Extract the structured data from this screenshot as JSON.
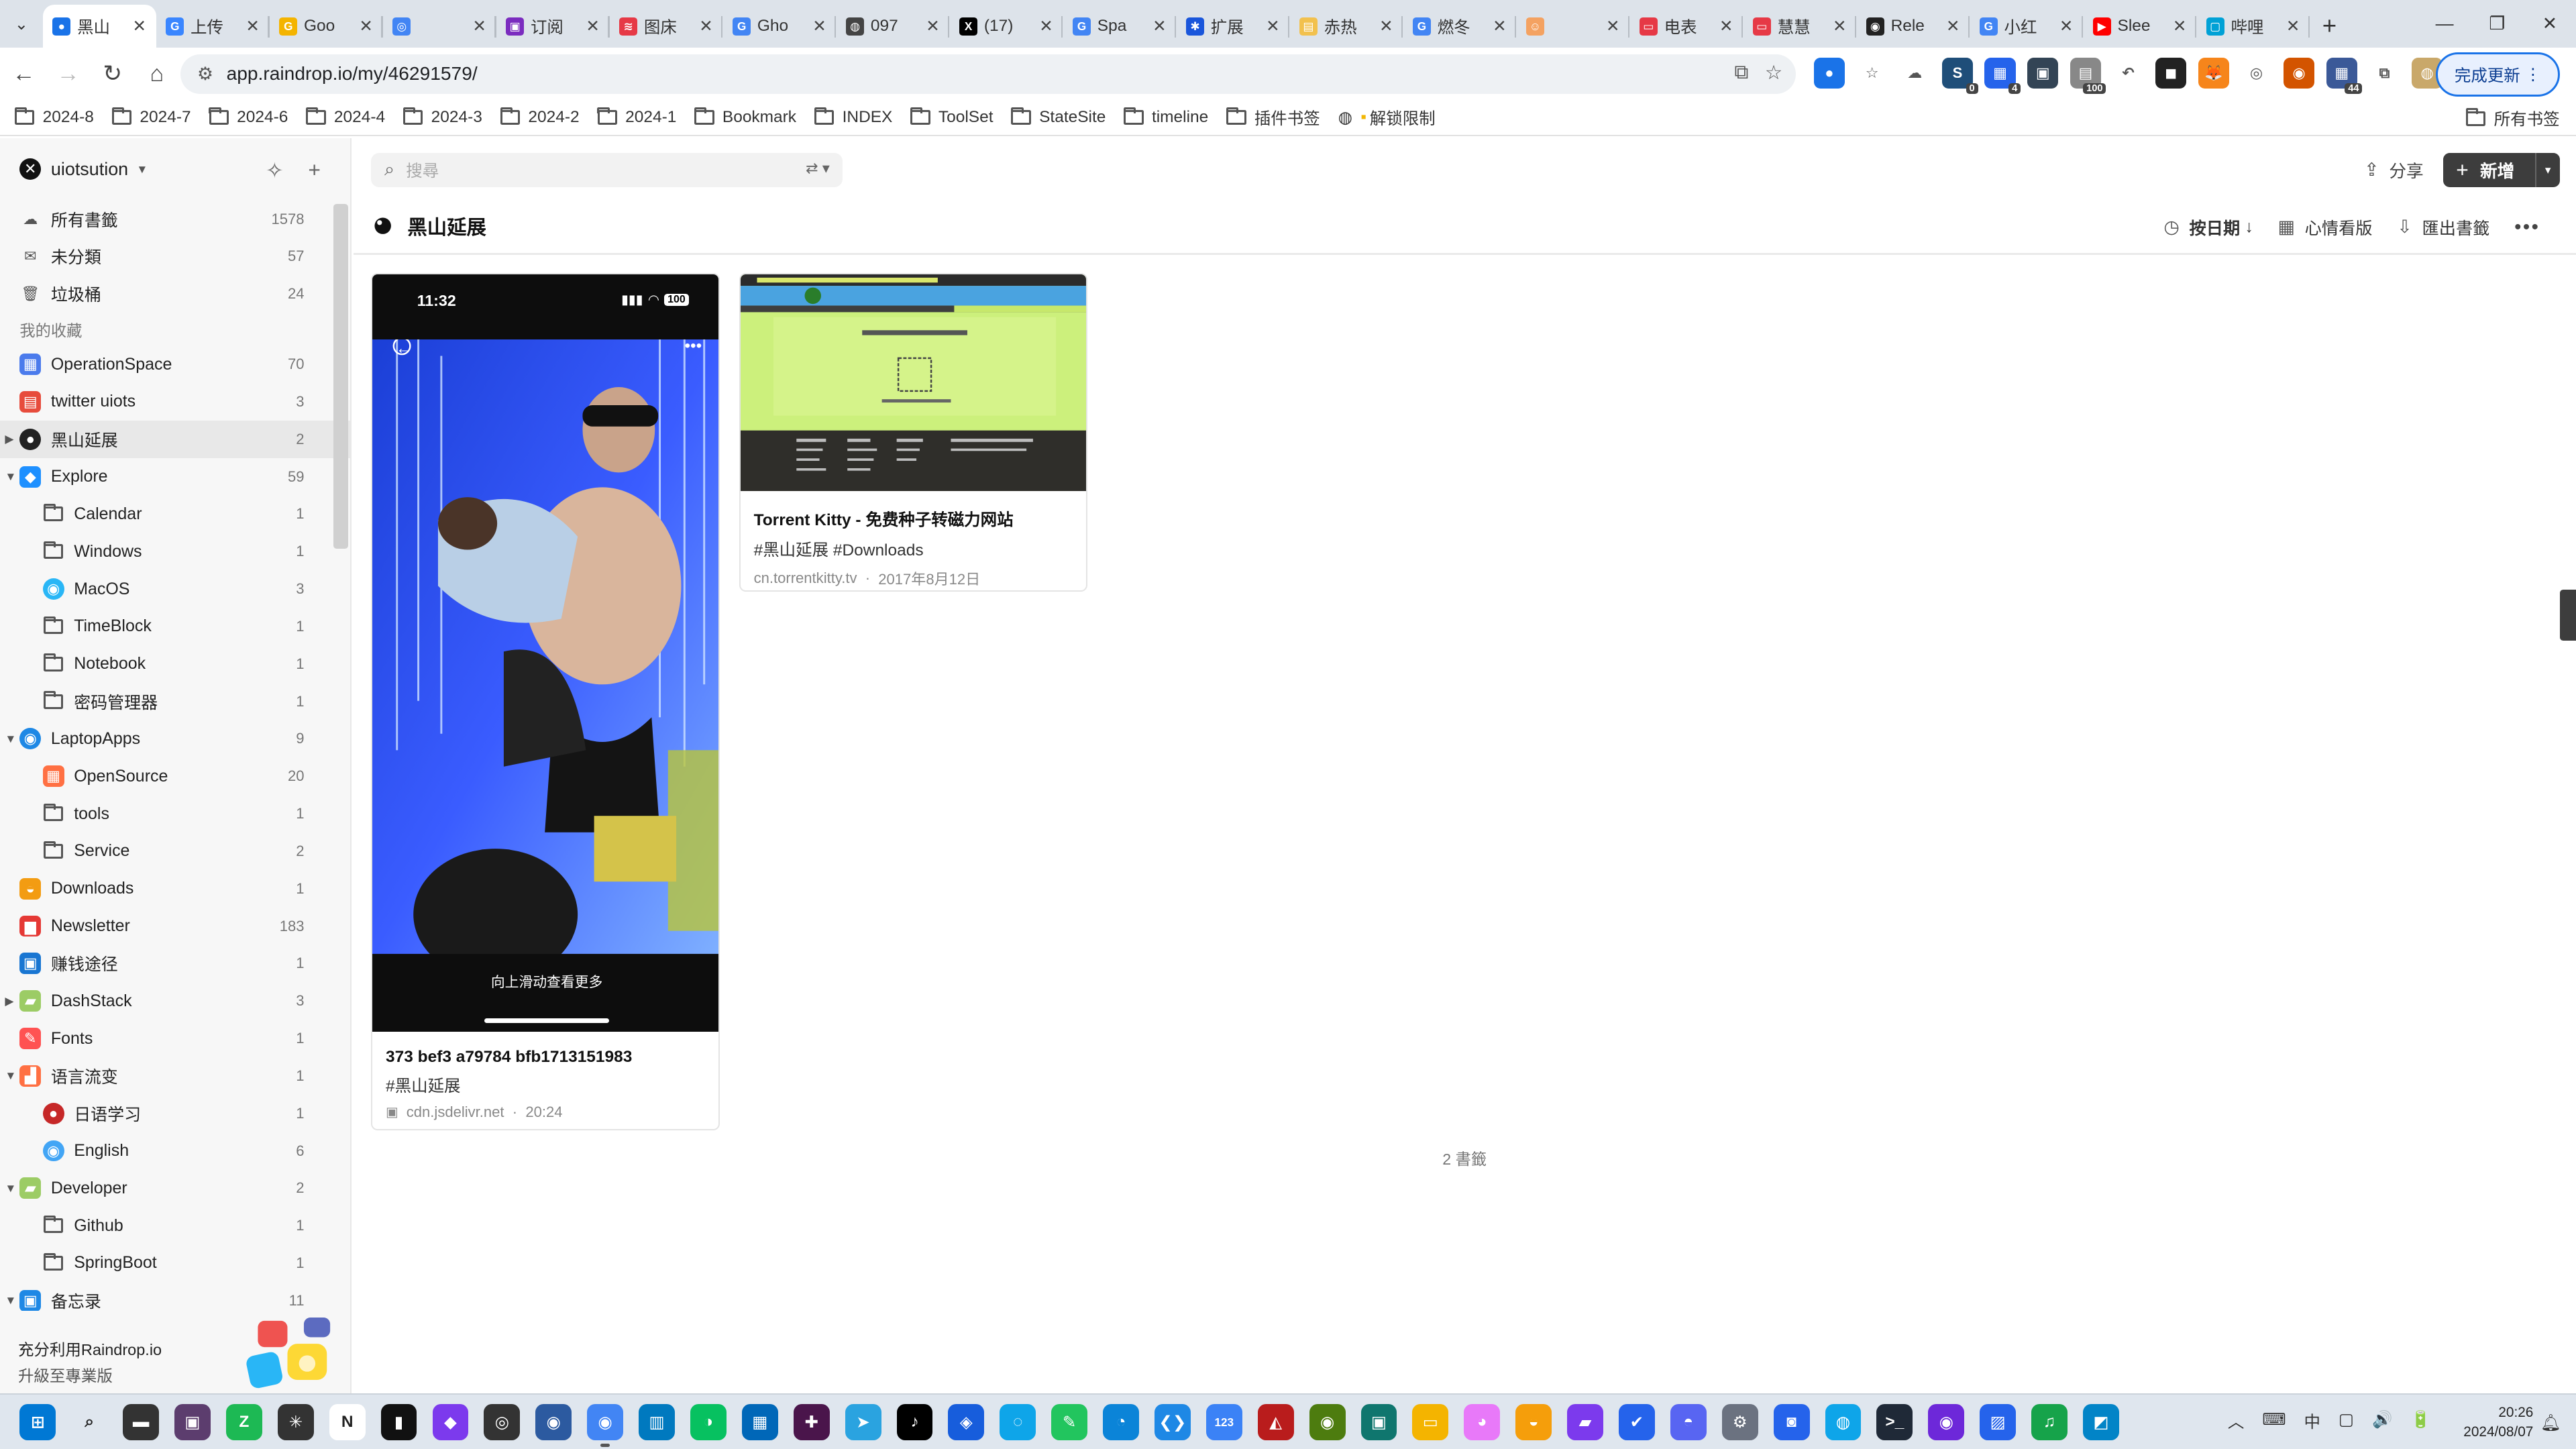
{
  "tabs": [
    {
      "title": "黑山",
      "fav_color": "#1a73e8",
      "fav_glyph": "●",
      "active": true
    },
    {
      "title": "上传",
      "fav_color": "#3a86ff",
      "fav_glyph": "G"
    },
    {
      "title": "Goo",
      "fav_color": "#f4b400",
      "fav_glyph": "G"
    },
    {
      "title": "",
      "fav_color": "#4285f4",
      "fav_glyph": "◎"
    },
    {
      "title": "订阅",
      "fav_color": "#7b2cbf",
      "fav_glyph": "▣"
    },
    {
      "title": "图床",
      "fav_color": "#e63946",
      "fav_glyph": "≋"
    },
    {
      "title": "Gho",
      "fav_color": "#4285f4",
      "fav_glyph": "G"
    },
    {
      "title": "097",
      "fav_color": "#444444",
      "fav_glyph": "◍"
    },
    {
      "title": "(17)",
      "fav_color": "#000000",
      "fav_glyph": "X"
    },
    {
      "title": "Spa",
      "fav_color": "#4285f4",
      "fav_glyph": "G"
    },
    {
      "title": "扩展",
      "fav_color": "#1a56db",
      "fav_glyph": "✱"
    },
    {
      "title": "赤热",
      "fav_color": "#f2c14e",
      "fav_glyph": "▤"
    },
    {
      "title": "燃冬",
      "fav_color": "#4285f4",
      "fav_glyph": "G"
    },
    {
      "title": "",
      "fav_color": "#f4a261",
      "fav_glyph": "☺"
    },
    {
      "title": "电表",
      "fav_color": "#e63946",
      "fav_glyph": "▭"
    },
    {
      "title": "慧慧",
      "fav_color": "#e63946",
      "fav_glyph": "▭"
    },
    {
      "title": "Rele",
      "fav_color": "#222222",
      "fav_glyph": "◉"
    },
    {
      "title": "小红",
      "fav_color": "#4285f4",
      "fav_glyph": "G"
    },
    {
      "title": "Slee",
      "fav_color": "#ff0000",
      "fav_glyph": "▶"
    },
    {
      "title": "哔哩",
      "fav_color": "#00a1d6",
      "fav_glyph": "▢"
    }
  ],
  "address": {
    "url": "app.raindrop.io/my/46291579/"
  },
  "extensions": [
    {
      "name": "blue-dot",
      "color": "#1a73e8",
      "glyph": "●"
    },
    {
      "name": "star",
      "color": "#ffffff",
      "glyph": "☆"
    },
    {
      "name": "cloud",
      "color": "#ffffff",
      "glyph": "☁"
    },
    {
      "name": "ext-0",
      "color": "#1f4e79",
      "glyph": "S",
      "badge": "0"
    },
    {
      "name": "ext-4",
      "color": "#2563eb",
      "glyph": "▦",
      "badge": "4"
    },
    {
      "name": "ext-screen",
      "color": "#345",
      "glyph": "▣"
    },
    {
      "name": "ext-100",
      "color": "#888888",
      "glyph": "▤",
      "badge": "100"
    },
    {
      "name": "back-arrow",
      "color": "#ffffff",
      "glyph": "↶"
    },
    {
      "name": "ext-dark",
      "color": "#222222",
      "glyph": "◼"
    },
    {
      "name": "metamask",
      "color": "#f6851b",
      "glyph": "🦊"
    },
    {
      "name": "ext-orange",
      "color": "#ffffff",
      "glyph": "◎"
    },
    {
      "name": "ext-cookie",
      "color": "#d35400",
      "glyph": "◉"
    },
    {
      "name": "ext-44",
      "color": "#3b5998",
      "glyph": "▦",
      "badge": "44"
    },
    {
      "name": "puzzle",
      "color": "#ffffff",
      "glyph": "⧉"
    },
    {
      "name": "avatar",
      "color": "#c9a86a",
      "glyph": "◍"
    }
  ],
  "update_label": "完成更新",
  "bookmarks": [
    "2024-8",
    "2024-7",
    "2024-6",
    "2024-4",
    "2024-3",
    "2024-2",
    "2024-1",
    "Bookmark",
    "INDEX",
    "ToolSet",
    "StateSite",
    "timeline",
    "插件书签"
  ],
  "bookmark_special": "解锁限制",
  "bookmark_all": "所有书签",
  "sidebar": {
    "user": "uiotsution",
    "top_items": [
      {
        "label": "所有書籤",
        "count": "1578",
        "icon": "☁",
        "icon_color": "#555"
      },
      {
        "label": "未分類",
        "count": "57",
        "icon": "✉",
        "icon_color": "#555"
      },
      {
        "label": "垃圾桶",
        "count": "24",
        "icon": "🗑",
        "icon_color": "#555"
      }
    ],
    "group_label": "我的收藏",
    "collections": [
      {
        "label": "OperationSpace",
        "count": "70",
        "level": 0,
        "icon": "▦",
        "icon_bg": "#4b7bec",
        "arrow": ""
      },
      {
        "label": "twitter uiots",
        "count": "3",
        "level": 0,
        "icon": "▤",
        "icon_bg": "#e74c3c",
        "arrow": ""
      },
      {
        "label": "黑山延展",
        "count": "2",
        "level": 0,
        "icon": "●",
        "icon_bg": "#222",
        "arrow": "▶",
        "selected": true
      },
      {
        "label": "Explore",
        "count": "59",
        "level": 0,
        "icon": "◆",
        "icon_bg": "#1e90ff",
        "arrow": "▼"
      },
      {
        "label": "Calendar",
        "count": "1",
        "level": 1,
        "icon": "folder"
      },
      {
        "label": "Windows",
        "count": "1",
        "level": 1,
        "icon": "folder"
      },
      {
        "label": "MacOS",
        "count": "3",
        "level": 1,
        "icon": "◉",
        "icon_bg": "#29b6f6"
      },
      {
        "label": "TimeBlock",
        "count": "1",
        "level": 1,
        "icon": "folder"
      },
      {
        "label": "Notebook",
        "count": "1",
        "level": 1,
        "icon": "folder"
      },
      {
        "label": "密码管理器",
        "count": "1",
        "level": 1,
        "icon": "folder"
      },
      {
        "label": "LaptopApps",
        "count": "9",
        "level": 0,
        "icon": "◉",
        "icon_bg": "#1e88e5",
        "arrow": "▼"
      },
      {
        "label": "OpenSource",
        "count": "20",
        "level": 1,
        "icon": "▦",
        "icon_bg": "#ff7043"
      },
      {
        "label": "tools",
        "count": "1",
        "level": 1,
        "icon": "folder"
      },
      {
        "label": "Service",
        "count": "2",
        "level": 1,
        "icon": "folder"
      },
      {
        "label": "Downloads",
        "count": "1",
        "level": 0,
        "icon": "◒",
        "icon_bg": "#f39c12"
      },
      {
        "label": "Newsletter",
        "count": "183",
        "level": 0,
        "icon": "▆",
        "icon_bg": "#e53935"
      },
      {
        "label": "赚钱途径",
        "count": "1",
        "level": 0,
        "icon": "▣",
        "icon_bg": "#1976d2"
      },
      {
        "label": "DashStack",
        "count": "3",
        "level": 0,
        "icon": "▰",
        "icon_bg": "#9ccc65",
        "arrow": "▶"
      },
      {
        "label": "Fonts",
        "count": "1",
        "level": 0,
        "icon": "✎",
        "icon_bg": "#ff5252"
      },
      {
        "label": "语言流变",
        "count": "1",
        "level": 0,
        "icon": "▟",
        "icon_bg": "#ff7043",
        "arrow": "▼"
      },
      {
        "label": "日语学习",
        "count": "1",
        "level": 1,
        "icon": "●",
        "icon_bg": "#c62828"
      },
      {
        "label": "English",
        "count": "6",
        "level": 1,
        "icon": "◉",
        "icon_bg": "#42a5f5"
      },
      {
        "label": "Developer",
        "count": "2",
        "level": 0,
        "icon": "▰",
        "icon_bg": "#9ccc65",
        "arrow": "▼"
      },
      {
        "label": "Github",
        "count": "1",
        "level": 1,
        "icon": "folder"
      },
      {
        "label": "SpringBoot",
        "count": "1",
        "level": 1,
        "icon": "folder"
      },
      {
        "label": "备忘录",
        "count": "11",
        "level": 0,
        "icon": "▣",
        "icon_bg": "#1e88e5",
        "arrow": "▼"
      }
    ],
    "promo_title": "充分利用Raindrop.io",
    "promo_sub": "升級至專業版"
  },
  "main": {
    "search_placeholder": "搜尋",
    "share_label": "分享",
    "new_label": "新增",
    "collection_title": "黑山延展",
    "sort_label": "按日期",
    "view_label": "心情看版",
    "export_label": "匯出書籤",
    "total_label": "2 書籤"
  },
  "cards": [
    {
      "title": "373 bef3 a79784 bfb1713151983",
      "tags": "#黑山延展",
      "domain": "cdn.jsdelivr.net",
      "date": "20:24",
      "phone_time": "11:32",
      "phone_battery": "100",
      "phone_caption": "向上滑动查看更多"
    },
    {
      "title": "Torrent Kitty - 免费种子转磁力网站",
      "tags": "#黑山延展  #Downloads",
      "domain": "cn.torrentkitty.tv",
      "date": "2017年8月12日"
    }
  ],
  "taskbar": {
    "apps": [
      {
        "name": "start",
        "color": "#0078d4",
        "glyph": "⊞"
      },
      {
        "name": "search",
        "color": "#dfe6ee",
        "glyph": "⌕"
      },
      {
        "name": "task-view",
        "color": "#333333",
        "glyph": "▬"
      },
      {
        "name": "app-dark",
        "color": "#5c3d6e",
        "glyph": "▣"
      },
      {
        "name": "app-green",
        "color": "#1db954",
        "glyph": "Z"
      },
      {
        "name": "app-perplexity",
        "color": "#333333",
        "glyph": "✳"
      },
      {
        "name": "notion",
        "color": "#ffffff",
        "glyph": "N"
      },
      {
        "name": "app-black",
        "color": "#111111",
        "glyph": "▮"
      },
      {
        "name": "obsidian",
        "color": "#7c3aed",
        "glyph": "◆"
      },
      {
        "name": "chatgpt",
        "color": "#333333",
        "glyph": "◎"
      },
      {
        "name": "app-blue",
        "color": "#2c5aa0",
        "glyph": "◉"
      },
      {
        "name": "chrome",
        "color": "#4285f4",
        "glyph": "◉",
        "running": true
      },
      {
        "name": "trello",
        "color": "#0079bf",
        "glyph": "▥"
      },
      {
        "name": "wechat",
        "color": "#07c160",
        "glyph": "◑"
      },
      {
        "name": "app-store",
        "color": "#0067b8",
        "glyph": "▦"
      },
      {
        "name": "slack",
        "color": "#4a154b",
        "glyph": "✚"
      },
      {
        "name": "telegram",
        "color": "#2aa3e0",
        "glyph": "➤"
      },
      {
        "name": "tiktok",
        "color": "#000000",
        "glyph": "♪"
      },
      {
        "name": "bitwarden",
        "color": "#175ddc",
        "glyph": "◈"
      },
      {
        "name": "app-light",
        "color": "#0ea5e9",
        "glyph": "◌"
      },
      {
        "name": "app-note",
        "color": "#22c55e",
        "glyph": "✎"
      },
      {
        "name": "edge",
        "color": "#0b84d8",
        "glyph": "◔"
      },
      {
        "name": "vscode",
        "color": "#1e88e5",
        "glyph": "❮❯"
      },
      {
        "name": "app-123",
        "color": "#3b82f6",
        "glyph": "123"
      },
      {
        "name": "app-red",
        "color": "#b91c1c",
        "glyph": "◭"
      },
      {
        "name": "app-olive",
        "color": "#4d7c0f",
        "glyph": "◉"
      },
      {
        "name": "app-teal",
        "color": "#0f766e",
        "glyph": "▣"
      },
      {
        "name": "explorer",
        "color": "#f4b400",
        "glyph": "▭"
      },
      {
        "name": "app-pink",
        "color": "#e879f9",
        "glyph": "◕"
      },
      {
        "name": "app-nut",
        "color": "#f59e0b",
        "glyph": "◒"
      },
      {
        "name": "app-folder",
        "color": "#7c3aed",
        "glyph": "▰"
      },
      {
        "name": "app-check",
        "color": "#2563eb",
        "glyph": "✔"
      },
      {
        "name": "discord",
        "color": "#5865f2",
        "glyph": "◓"
      },
      {
        "name": "settings",
        "color": "#6b7280",
        "glyph": "⚙"
      },
      {
        "name": "app-blue2",
        "color": "#2563eb",
        "glyph": "◙"
      },
      {
        "name": "app-map",
        "color": "#0ea5e9",
        "glyph": "◍"
      },
      {
        "name": "terminal",
        "color": "#1f2937",
        "glyph": ">_"
      },
      {
        "name": "app-purple",
        "color": "#6d28d9",
        "glyph": "◉"
      },
      {
        "name": "app-shield",
        "color": "#2563eb",
        "glyph": "▨"
      },
      {
        "name": "app-music",
        "color": "#16a34a",
        "glyph": "♫"
      },
      {
        "name": "app-img",
        "color": "#0284c7",
        "glyph": "◩"
      }
    ],
    "tray": [
      "︿",
      "⌨",
      "中",
      "▢",
      "🔊",
      "🔋"
    ],
    "time": "20:26",
    "date": "2024/08/07"
  }
}
